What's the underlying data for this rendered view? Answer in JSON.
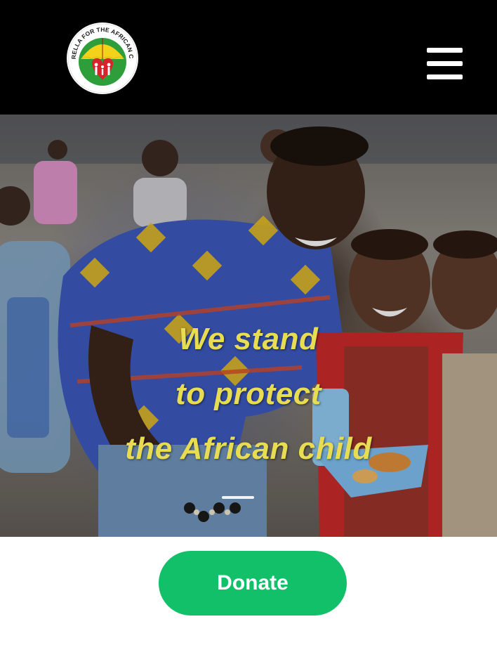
{
  "header": {
    "logo_text": "UMBRELLA FOR THE AFRICAN CHILD",
    "menu_icon": "hamburger-menu-icon",
    "background": "#000000"
  },
  "hero": {
    "line1": "We stand",
    "line2": "to protect",
    "line3": "the African child",
    "text_color": "#e8dd52",
    "slide_count": 1
  },
  "donate": {
    "label": "Donate",
    "color": "#12c06a"
  }
}
